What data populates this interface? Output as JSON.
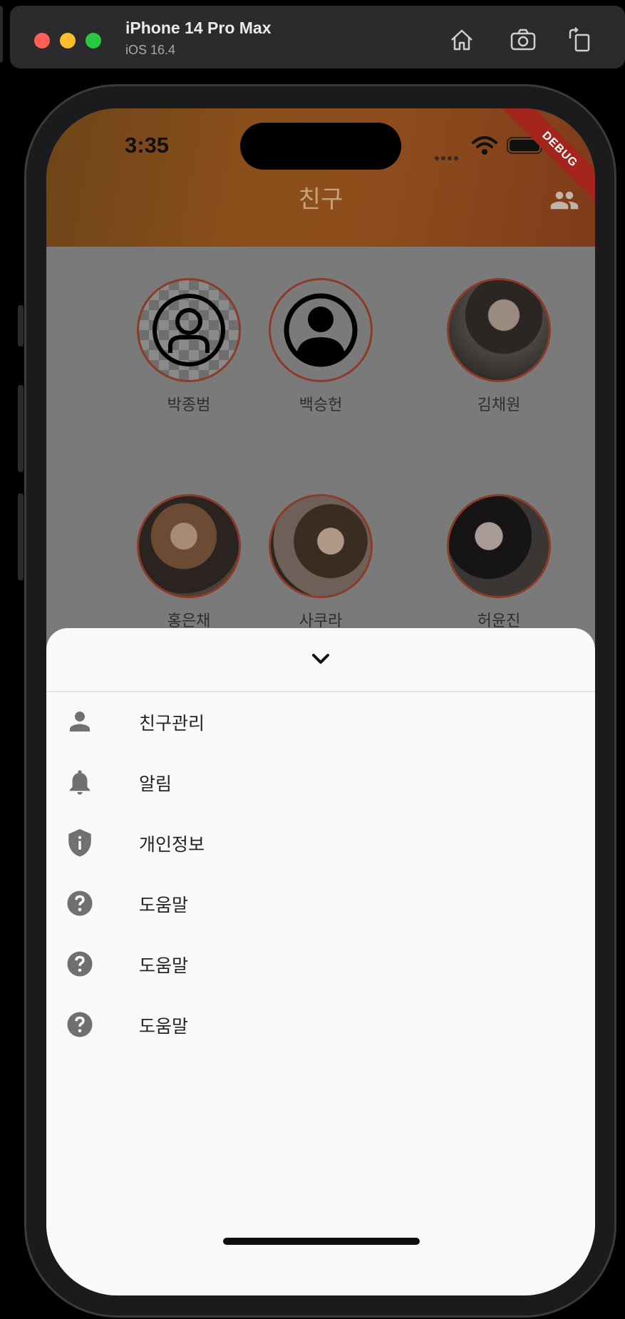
{
  "simulator": {
    "device_name": "iPhone 14 Pro Max",
    "os_version": "iOS 16.4",
    "buttons": [
      "home-icon",
      "screenshot-camera-icon",
      "rotate-icon"
    ]
  },
  "status_bar": {
    "time": "3:35",
    "debug_label": "DEBUG"
  },
  "app_bar": {
    "title": "친구",
    "action_icon": "people-icon"
  },
  "friends": [
    {
      "name": "박종범",
      "avatar": "default-person-outline"
    },
    {
      "name": "백승헌",
      "avatar": "default-person-filled"
    },
    {
      "name": "김채원",
      "avatar": "photo"
    },
    {
      "name": "홍은채",
      "avatar": "photo"
    },
    {
      "name": "사쿠라",
      "avatar": "photo"
    },
    {
      "name": "허윤진",
      "avatar": "photo"
    }
  ],
  "bottom_sheet": {
    "collapse_icon": "chevron-down-icon",
    "items": [
      {
        "label": "친구관리",
        "icon": "person-icon"
      },
      {
        "label": "알림",
        "icon": "bell-icon"
      },
      {
        "label": "개인정보",
        "icon": "shield-info-icon"
      },
      {
        "label": "도움말",
        "icon": "help-circle-icon"
      },
      {
        "label": "도움말",
        "icon": "help-circle-icon"
      },
      {
        "label": "도움말",
        "icon": "help-circle-icon"
      }
    ]
  },
  "colors": {
    "accent_orange": "#8c4f1a",
    "avatar_border": "#8b3b28",
    "debug_ribbon": "#a3251e",
    "sheet_background": "#fafafa",
    "scrim_gray": "#7a7a7a"
  }
}
